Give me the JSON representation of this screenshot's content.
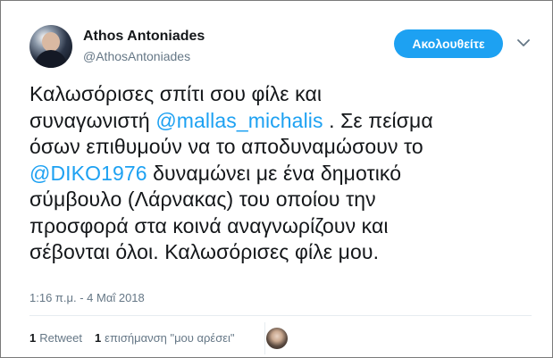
{
  "author": {
    "name": "Athos Antoniades",
    "handle": "@AthosAntoniades",
    "avatar_icon": "profile-photo"
  },
  "follow_button": {
    "label": "Ακολουθείτε",
    "color": "#1da1f2"
  },
  "tweet": {
    "lines": [
      [
        "Καλωσόρισες σπίτι σου φίλε και"
      ],
      [
        "συναγωνιστή ",
        {
          "mention": "@mallas_michalis"
        },
        " . Σε πείσμα"
      ],
      [
        "όσων επιθυμούν να το αποδυναμώσουν το"
      ],
      [
        {
          "mention": "@DIKO1976"
        },
        " δυναμώνει με ένα δημοτικό"
      ],
      [
        "σύμβουλο (Λάρνακας) του οποίου την"
      ],
      [
        "προσφορά στα κοινά αναγνωρίζουν και"
      ],
      [
        "σέβονται όλοι. Καλωσόρισες φίλε μου."
      ]
    ],
    "l1": "Καλωσόρισες σπίτι σου φίλε και",
    "l2a": "συναγωνιστή ",
    "l2m": "@mallas_michalis",
    "l2b": " . Σε πείσμα",
    "l3": "όσων επιθυμούν να το αποδυναμώσουν το",
    "l4m": "@DIKO1976",
    "l4b": " δυναμώνει με ένα δημοτικό",
    "l5": "σύμβουλο (Λάρνακας) του οποίου την",
    "l6": "προσφορά στα κοινά αναγνωρίζουν και",
    "l7": "σέβονται όλοι. Καλωσόρισες φίλε μου.",
    "mention_color": "#1da1f2"
  },
  "timestamp": "1:16 π.μ. - 4 Μαΐ 2018",
  "stats": {
    "retweets_count": "1",
    "retweets_label": "Retweet",
    "likes_count": "1",
    "likes_label": "επισήμανση \"μου αρέσει\""
  }
}
